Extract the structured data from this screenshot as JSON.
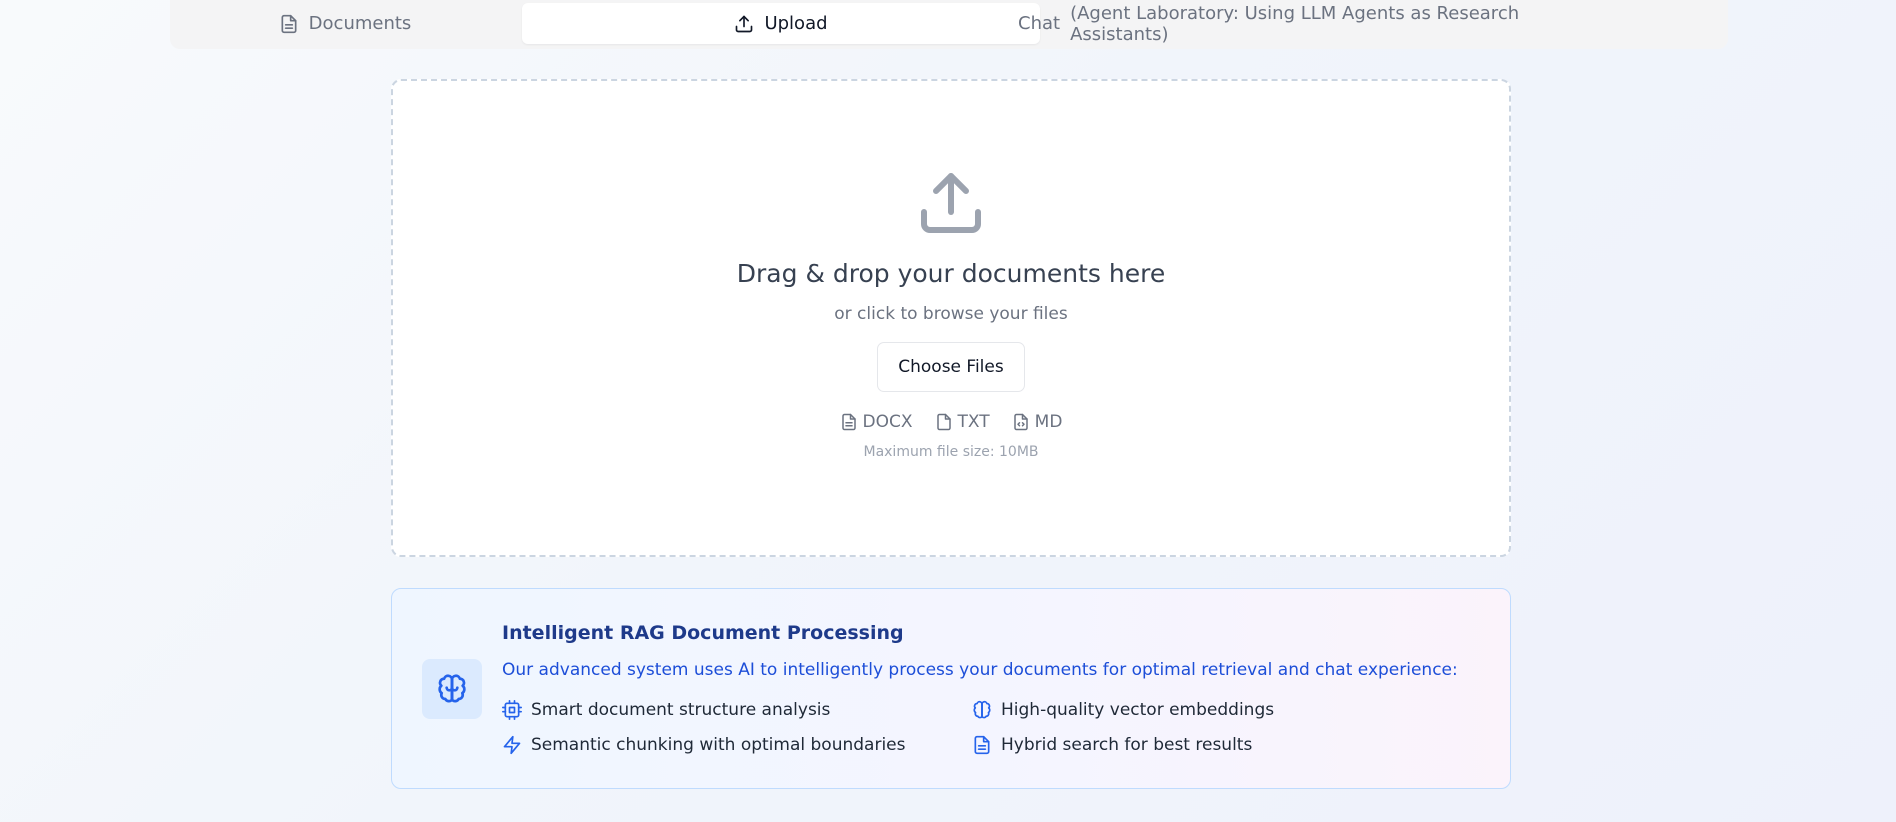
{
  "tabs": {
    "documents": "Documents",
    "upload": "Upload",
    "chat": "Chat",
    "chat_context": "(Agent Laboratory: Using LLM Agents as Research Assistants)"
  },
  "dropzone": {
    "title": "Drag & drop your documents here",
    "subtitle": "or click to browse your files",
    "button": "Choose Files",
    "types": [
      "DOCX",
      "TXT",
      "MD"
    ],
    "max_size": "Maximum file size: 10MB"
  },
  "info": {
    "title": "Intelligent RAG Document Processing",
    "description": "Our advanced system uses AI to intelligently process your documents for optimal retrieval and chat experience:",
    "features": [
      "Smart document structure analysis",
      "High-quality vector embeddings",
      "Semantic chunking with optimal boundaries",
      "Hybrid search for best results"
    ]
  },
  "colors": {
    "accent": "#2563eb",
    "title_blue": "#1e3a8a",
    "icon_gray": "#9ca3af"
  },
  "icons": [
    "file-text-icon",
    "upload-icon",
    "brain-icon",
    "cpu-icon",
    "zap-icon",
    "file-icon",
    "file-code-icon"
  ]
}
